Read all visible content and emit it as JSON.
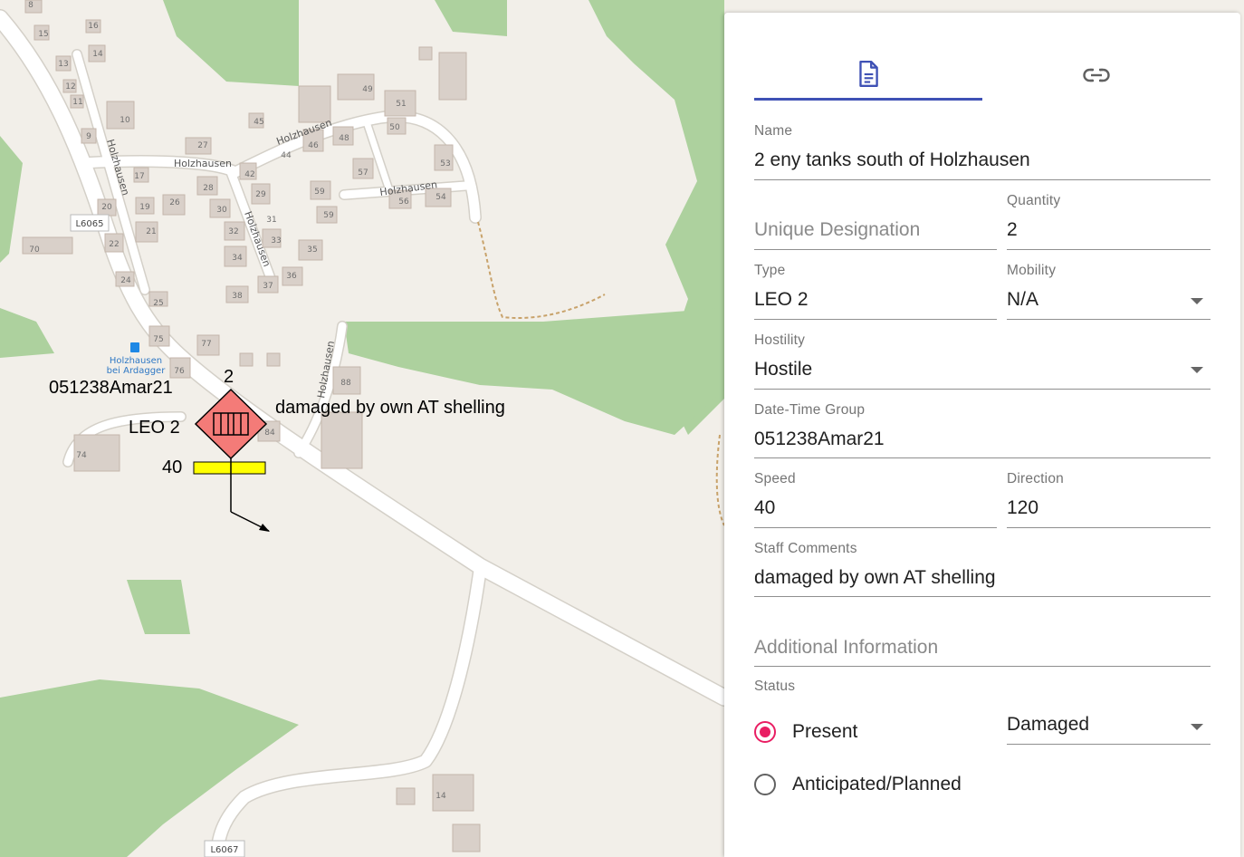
{
  "map": {
    "place_labels": [
      "Holzhausen",
      "Holzhausen",
      "Holzhausen",
      "Holzhausen",
      "Holzhausen",
      "Holzhausen"
    ],
    "road_refs": [
      "L6065",
      "L6067"
    ],
    "bus_stop": "Holzhausen bei Ardagger",
    "house_numbers": [
      "8",
      "15",
      "16",
      "14",
      "13",
      "12",
      "11",
      "10",
      "9",
      "17",
      "27",
      "45",
      "46",
      "44",
      "48",
      "49",
      "50",
      "51",
      "53",
      "57",
      "42",
      "28",
      "26",
      "29",
      "19",
      "20",
      "21",
      "22",
      "24",
      "25",
      "30",
      "31",
      "32",
      "33",
      "34",
      "35",
      "36",
      "37",
      "38",
      "59",
      "59",
      "56",
      "54",
      "70",
      "75",
      "76",
      "77",
      "84",
      "88",
      "74",
      "14"
    ]
  },
  "symbol": {
    "quantity": "2",
    "dtg": "051238Amar21",
    "type": "LEO 2",
    "comment": "damaged by own AT shelling",
    "speed": "40",
    "direction_deg": 120,
    "hostility_color": "#f47b78",
    "speed_bar_color": "#ffff00"
  },
  "panel": {
    "tabs": [
      {
        "icon": "document-icon",
        "active": true
      },
      {
        "icon": "link-icon",
        "active": false
      }
    ],
    "accent_color": "#3f51b5",
    "fields": {
      "name": {
        "label": "Name",
        "value": "2 eny tanks south of Holzhausen"
      },
      "unique_designation": {
        "placeholder": "Unique Designation",
        "value": ""
      },
      "quantity": {
        "label": "Quantity",
        "value": "2"
      },
      "type": {
        "label": "Type",
        "value": "LEO 2"
      },
      "mobility": {
        "label": "Mobility",
        "value": "N/A"
      },
      "hostility": {
        "label": "Hostility",
        "value": "Hostile"
      },
      "dtg": {
        "label": "Date-Time Group",
        "value": "051238Amar21"
      },
      "speed": {
        "label": "Speed",
        "value": "40"
      },
      "direction": {
        "label": "Direction",
        "value": "120"
      },
      "staff_comments": {
        "label": "Staff Comments",
        "value": "damaged by own AT shelling"
      },
      "additional_info": {
        "placeholder": "Additional Information",
        "value": ""
      }
    },
    "status": {
      "label": "Status",
      "options": [
        "Present",
        "Anticipated/Planned"
      ],
      "selected": "Present",
      "condition": "Damaged",
      "radio_color": "#e91e63"
    }
  }
}
